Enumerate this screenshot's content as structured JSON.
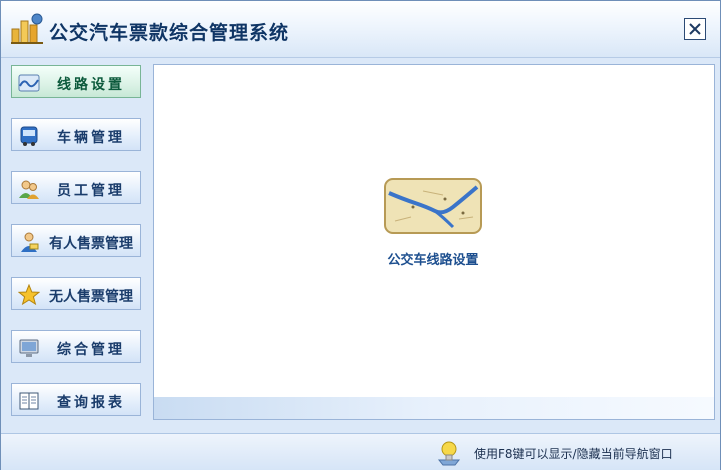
{
  "window": {
    "title": "公交汽车票款综合管理系统"
  },
  "sidebar": {
    "items": [
      {
        "label": "线路设置",
        "icon": "route-map-icon",
        "active": true
      },
      {
        "label": "车辆管理",
        "icon": "bus-icon",
        "active": false
      },
      {
        "label": "员工管理",
        "icon": "staff-users-icon",
        "active": false
      },
      {
        "label": "有人售票管理",
        "icon": "ticket-seller-icon",
        "active": false
      },
      {
        "label": "无人售票管理",
        "icon": "star-icon",
        "active": false
      },
      {
        "label": "综合管理",
        "icon": "monitor-icon",
        "active": false
      },
      {
        "label": "查询报表",
        "icon": "report-book-icon",
        "active": false
      }
    ]
  },
  "main": {
    "function_item": {
      "label": "公交车线路设置",
      "icon": "route-map-icon"
    }
  },
  "status": {
    "hint": "使用F8键可以显示/隐藏当前导航窗口",
    "icon": "lightbulb-icon"
  },
  "colors": {
    "title_text": "#0f3565",
    "nav_text": "#1a3c6b",
    "active_nav_text": "#0c5a3c",
    "function_caption": "#1d4f8f"
  }
}
